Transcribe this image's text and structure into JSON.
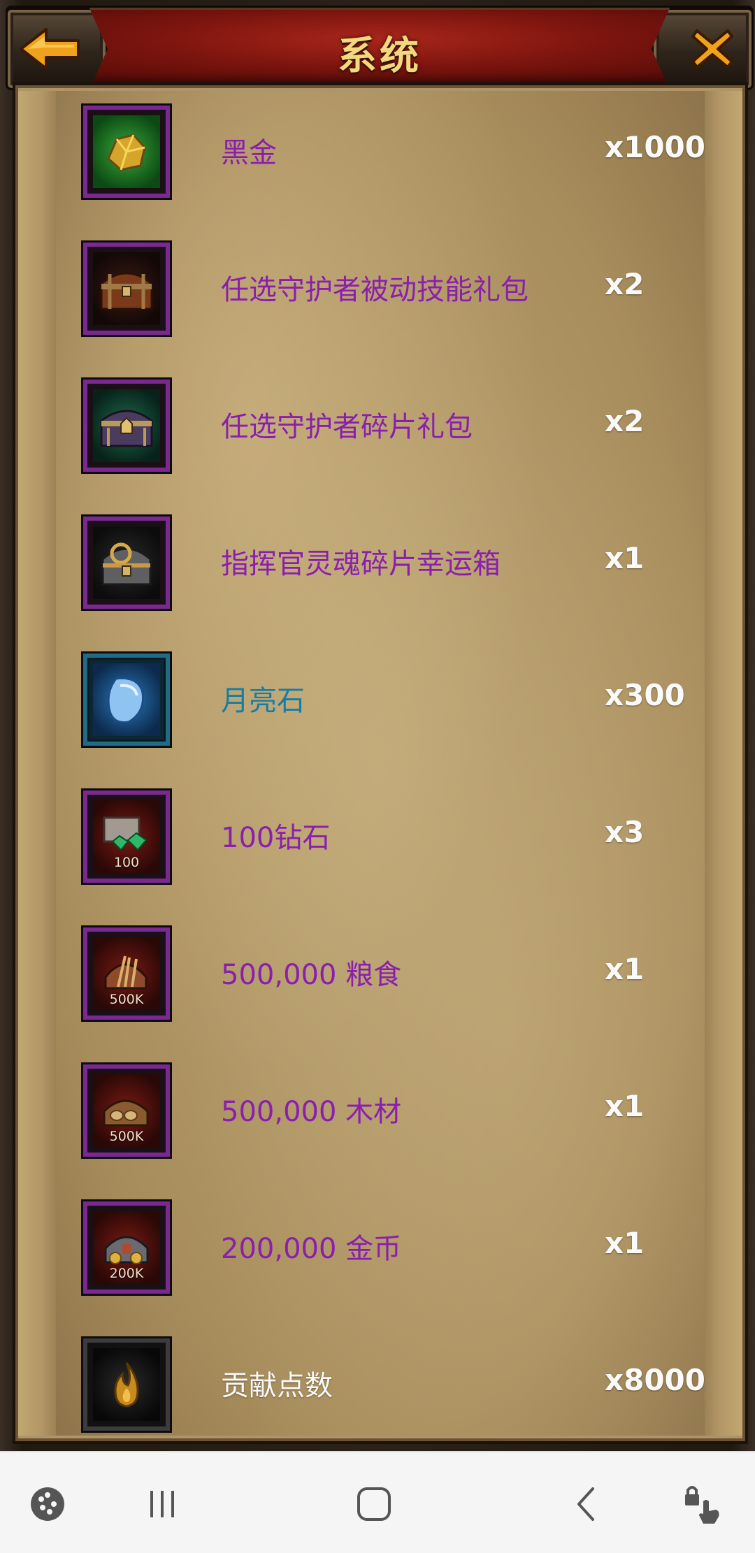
{
  "header": {
    "title": "系统"
  },
  "items": [
    {
      "name": "黑金",
      "qty": "x1000",
      "icon": "gold-ore-icon",
      "tag": "",
      "name_color": "purple"
    },
    {
      "name": "任选守护者被动技能礼包",
      "qty": "x2",
      "icon": "treasure-chest-icon",
      "tag": "",
      "name_color": "purple"
    },
    {
      "name": "任选守护者碎片礼包",
      "qty": "x2",
      "icon": "ornate-chest-icon",
      "tag": "",
      "name_color": "purple"
    },
    {
      "name": "指挥官灵魂碎片幸运箱",
      "qty": "x1",
      "icon": "lucky-box-icon",
      "tag": "",
      "name_color": "purple"
    },
    {
      "name": "月亮石",
      "qty": "x300",
      "icon": "moonstone-icon",
      "tag": "",
      "name_color": "cyan"
    },
    {
      "name": "100钻石",
      "qty": "x3",
      "icon": "diamond-chest-icon",
      "tag": "100",
      "name_color": "purple"
    },
    {
      "name": "500,000 粮食",
      "qty": "x1",
      "icon": "food-crate-icon",
      "tag": "500K",
      "name_color": "purple"
    },
    {
      "name": "500,000 木材",
      "qty": "x1",
      "icon": "wood-crate-icon",
      "tag": "500K",
      "name_color": "purple"
    },
    {
      "name": "200,000 金币",
      "qty": "x1",
      "icon": "gold-coin-crate-icon",
      "tag": "200K",
      "name_color": "purple"
    },
    {
      "name": "贡献点数",
      "qty": "x8000",
      "icon": "flame-icon",
      "tag": "",
      "name_color": "white"
    }
  ],
  "navbar": {
    "icons": [
      "game-launcher-icon",
      "recent-apps-icon",
      "home-icon",
      "back-icon",
      "lock-touch-icon"
    ]
  },
  "colors": {
    "purple_text": "#8a1fae",
    "cyan_text": "#167da6",
    "header_red": "#7a140e",
    "title_gold": "#f3d880",
    "parchment": "#b39767"
  }
}
